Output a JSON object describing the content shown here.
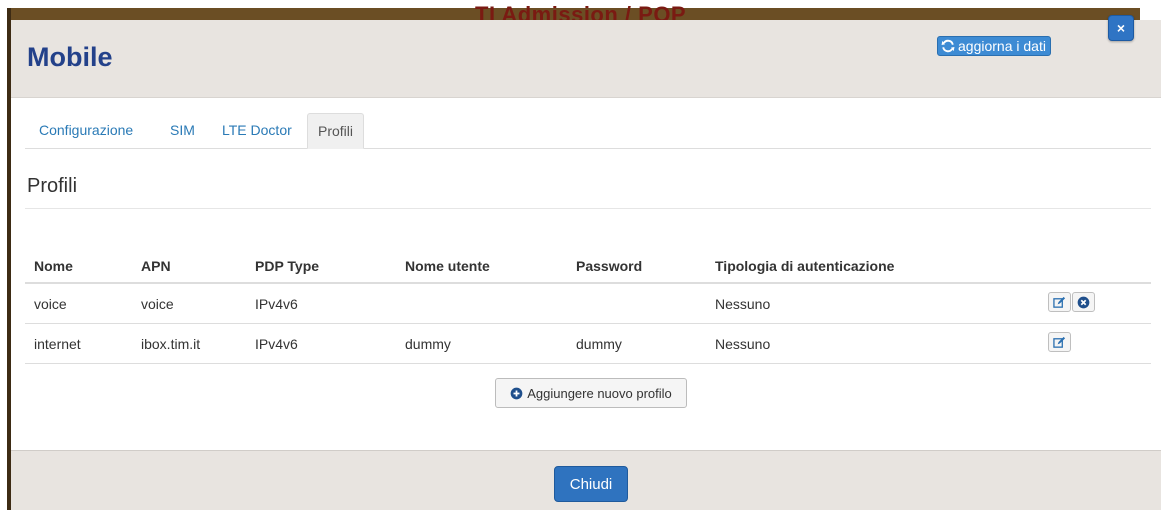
{
  "background": {
    "title": "TI Admission / POP"
  },
  "modal": {
    "title": "Mobile",
    "refresh_label": "aggiorna i dati",
    "close_x": "×"
  },
  "tabs": [
    {
      "label": "Configurazione",
      "active": false
    },
    {
      "label": "SIM",
      "active": false
    },
    {
      "label": "LTE Doctor",
      "active": false
    },
    {
      "label": "Profili",
      "active": true
    }
  ],
  "section": {
    "title": "Profili"
  },
  "table": {
    "headers": [
      "Nome",
      "APN",
      "PDP Type",
      "Nome utente",
      "Password",
      "Tipologia di autenticazione"
    ],
    "rows": [
      {
        "cells": [
          "voice",
          "voice",
          "IPv4v6",
          "",
          "",
          "Nessuno"
        ],
        "actions": [
          "edit",
          "delete"
        ]
      },
      {
        "cells": [
          "internet",
          "ibox.tim.it",
          "IPv4v6",
          "dummy",
          "dummy",
          "Nessuno"
        ],
        "actions": [
          "edit"
        ]
      }
    ]
  },
  "add_button": {
    "label": "Aggiungere nuovo profilo"
  },
  "footer": {
    "close_label": "Chiudi"
  },
  "colors": {
    "primary": "#2f73bf",
    "header_bg": "#e8e4e0",
    "title": "#23418a",
    "link": "#2a7ab6"
  }
}
